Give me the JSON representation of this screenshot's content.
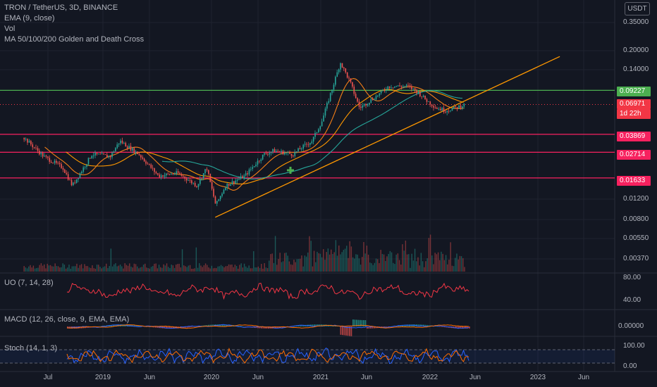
{
  "header": {
    "symbol": "TRON / TetherUS, 3D, BINANCE",
    "indicators": [
      "EMA (9, close)",
      "Vol",
      "MA 50/100/200 Golden and Death Cross"
    ]
  },
  "currency_badge": "USDT",
  "price_axis": {
    "labels": [
      "0.35000",
      "0.20000",
      "0.14000",
      "0.01200",
      "0.00800",
      "0.00550",
      "0.00370"
    ]
  },
  "price_tags": [
    {
      "value": "0.09227",
      "color": "#4caf50"
    },
    {
      "value": "0.06971",
      "color": "#f23645",
      "countdown": "1d 22h"
    },
    {
      "value": "0.03869",
      "color": "#f7215f"
    },
    {
      "value": "0.02714",
      "color": "#f7215f"
    },
    {
      "value": "0.01633",
      "color": "#f7215f"
    }
  ],
  "panes": {
    "uo": {
      "title": "UO (7, 14, 28)",
      "axis": [
        "80.00",
        "40.00"
      ]
    },
    "macd": {
      "title": "MACD (12, 26, close, 9, EMA, EMA)",
      "axis": [
        "0.00000"
      ]
    },
    "stoch": {
      "title": "Stoch (14, 1, 3)",
      "axis": [
        "100.00",
        "0.00"
      ]
    }
  },
  "time_axis": [
    "Jul",
    "2019",
    "Jun",
    "2020",
    "Jun",
    "2021",
    "Jun",
    "2022",
    "Jun",
    "2023",
    "Jun"
  ],
  "chart_data": {
    "type": "line",
    "title": "TRON / TetherUS, 3D, BINANCE",
    "y_scale": "log",
    "series": [
      {
        "name": "TRON / TetherUS",
        "x": [
          "2018-07",
          "2018-09",
          "2018-11",
          "2018-12",
          "2019-02",
          "2019-04",
          "2019-05",
          "2019-07",
          "2019-09",
          "2019-11",
          "2020-01",
          "2020-02",
          "2020-03",
          "2020-04",
          "2020-06",
          "2020-08",
          "2020-09",
          "2020-11",
          "2020-12",
          "2021-01",
          "2021-02",
          "2021-04",
          "2021-05",
          "2021-06",
          "2021-08",
          "2021-09",
          "2021-11",
          "2021-12",
          "2022-01",
          "2022-02",
          "2022-03",
          "2022-04",
          "2022-05"
        ],
        "values": [
          0.036,
          0.025,
          0.02,
          0.014,
          0.026,
          0.025,
          0.034,
          0.026,
          0.017,
          0.018,
          0.014,
          0.02,
          0.0095,
          0.014,
          0.017,
          0.026,
          0.028,
          0.026,
          0.03,
          0.034,
          0.05,
          0.16,
          0.11,
          0.065,
          0.085,
          0.1,
          0.1,
          0.09,
          0.075,
          0.065,
          0.062,
          0.065,
          0.06971
        ]
      }
    ],
    "horizontal_levels": [
      0.09227,
      0.03869,
      0.02714,
      0.01633
    ],
    "trendline": {
      "from": [
        "2020-03",
        0.0075
      ],
      "to": [
        "2023-03",
        0.18
      ]
    },
    "last_price": 0.06971,
    "x_ticks": [
      "Jul",
      "2019",
      "Jun",
      "2020",
      "Jun",
      "2021",
      "Jun",
      "2022",
      "Jun",
      "2023",
      "Jun"
    ],
    "grid": true,
    "legend": "top-left"
  }
}
